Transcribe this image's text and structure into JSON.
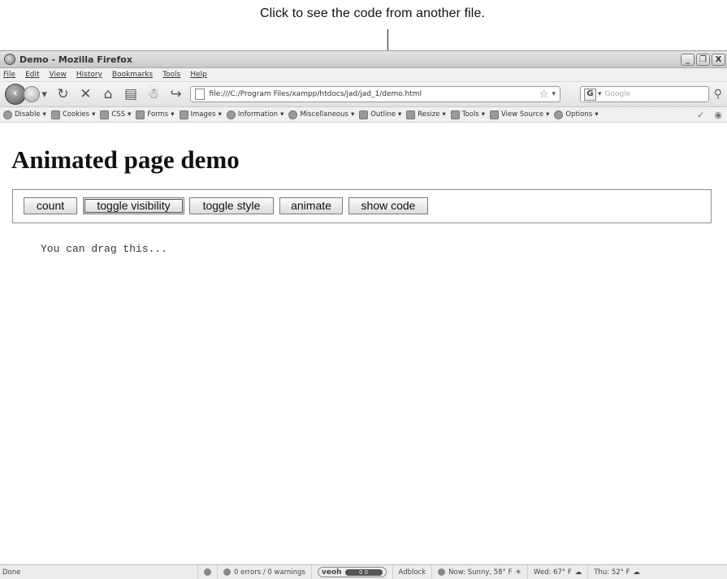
{
  "callout": {
    "text": "Click to see the code from another file."
  },
  "window": {
    "title": "Demo - Mozilla Firefox",
    "controls": {
      "minimize": "_",
      "restore": "❐",
      "close": "X"
    }
  },
  "menu": {
    "items": [
      "File",
      "Edit",
      "View",
      "History",
      "Bookmarks",
      "Tools",
      "Help"
    ]
  },
  "navbar": {
    "url": "file:///C:/Program Files/xampp/htdocs/jad/jad_1/demo.html",
    "search_placeholder": "Google"
  },
  "devbar": {
    "items": [
      "Disable",
      "Cookies",
      "CSS",
      "Forms",
      "Images",
      "Information",
      "Miscellaneous",
      "Outline",
      "Resize",
      "Tools",
      "View Source",
      "Options"
    ]
  },
  "page": {
    "heading": "Animated page demo",
    "buttons": [
      "count",
      "toggle visibility",
      "toggle style",
      "animate",
      "show code"
    ],
    "drag_text": "You can drag this..."
  },
  "status": {
    "left": "Done",
    "errors": "0 errors / 0 warnings",
    "veoh": "veoh",
    "veoh_counts": "0   0",
    "adblock": "Adblock",
    "weather_now": "Now: Sunny, 58° F",
    "weather_wed": "Wed: 67° F",
    "weather_thu": "Thu: 52° F"
  }
}
